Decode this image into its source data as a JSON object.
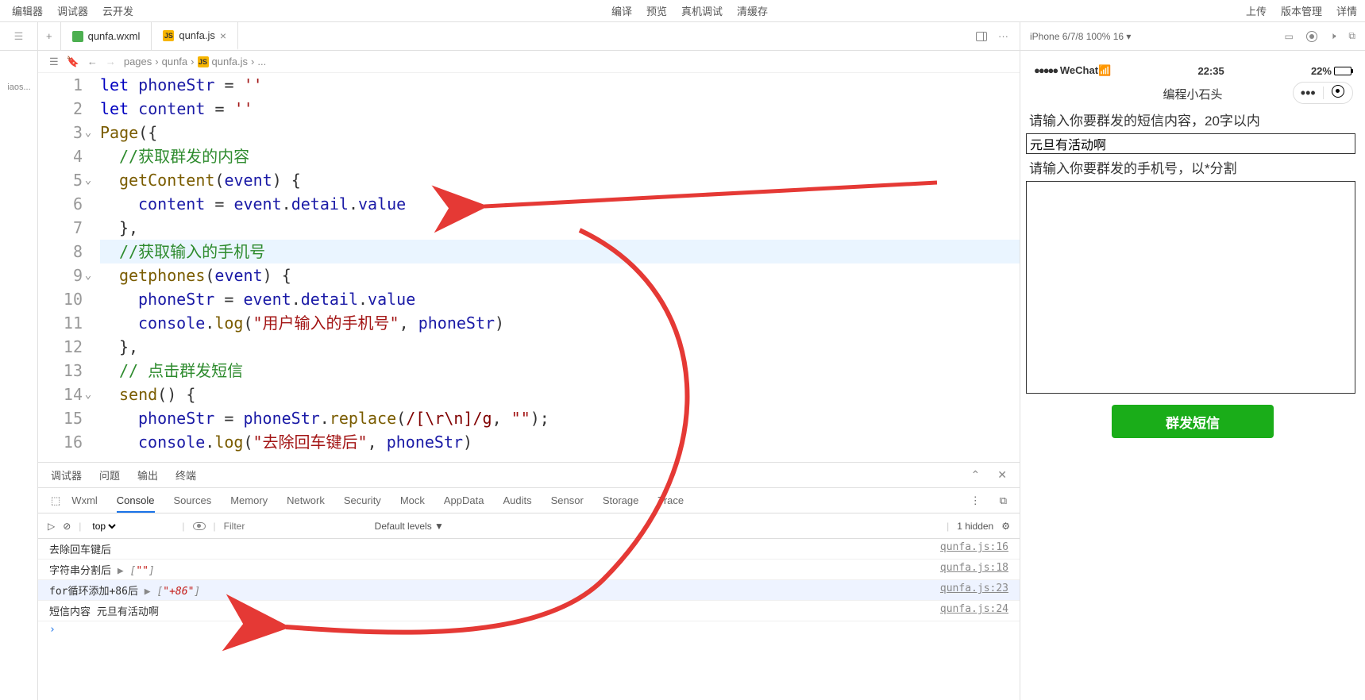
{
  "topbar": {
    "left": [
      "编辑器",
      "调试器",
      "云开发"
    ],
    "center": [
      "编译",
      "预览",
      "真机调试",
      "清缓存"
    ],
    "right": [
      "上传",
      "版本管理",
      "详情"
    ]
  },
  "sidebar": {
    "project_hint": "iaos..."
  },
  "tabs": [
    {
      "type": "wxml",
      "name": "qunfa.wxml",
      "active": false
    },
    {
      "type": "js",
      "name": "qunfa.js",
      "active": true
    }
  ],
  "breadcrumb": {
    "parts": [
      "pages",
      "qunfa",
      "qunfa.js",
      "..."
    ]
  },
  "code": {
    "lines": [
      {
        "n": 1,
        "tokens": [
          [
            "kw",
            "let"
          ],
          [
            "sp",
            " "
          ],
          [
            "id",
            "phoneStr"
          ],
          [
            "sp",
            " "
          ],
          [
            "op",
            "="
          ],
          [
            "sp",
            " "
          ],
          [
            "str",
            "''"
          ]
        ]
      },
      {
        "n": 2,
        "tokens": [
          [
            "kw",
            "let"
          ],
          [
            "sp",
            " "
          ],
          [
            "id",
            "content"
          ],
          [
            "sp",
            " "
          ],
          [
            "op",
            "="
          ],
          [
            "sp",
            " "
          ],
          [
            "str",
            "''"
          ]
        ]
      },
      {
        "n": 3,
        "fold": true,
        "tokens": [
          [
            "fn",
            "Page"
          ],
          [
            "p",
            "("
          ],
          [
            "p",
            "{"
          ]
        ]
      },
      {
        "n": 4,
        "indent": 1,
        "tokens": [
          [
            "com",
            "//获取群发的内容"
          ]
        ]
      },
      {
        "n": 5,
        "fold": true,
        "indent": 1,
        "tokens": [
          [
            "fn",
            "getContent"
          ],
          [
            "p",
            "("
          ],
          [
            "id",
            "event"
          ],
          [
            "p",
            ")"
          ],
          [
            "sp",
            " "
          ],
          [
            "p",
            "{"
          ]
        ]
      },
      {
        "n": 6,
        "indent": 2,
        "tokens": [
          [
            "id",
            "content"
          ],
          [
            "sp",
            " "
          ],
          [
            "op",
            "="
          ],
          [
            "sp",
            " "
          ],
          [
            "id",
            "event"
          ],
          [
            "p",
            "."
          ],
          [
            "id",
            "detail"
          ],
          [
            "p",
            "."
          ],
          [
            "id",
            "value"
          ]
        ]
      },
      {
        "n": 7,
        "indent": 1,
        "tokens": [
          [
            "p",
            "}"
          ],
          [
            "p",
            ","
          ]
        ]
      },
      {
        "n": 8,
        "hl": true,
        "indent": 1,
        "tokens": [
          [
            "com",
            "//获取输入的手机号"
          ]
        ]
      },
      {
        "n": 9,
        "fold": true,
        "indent": 1,
        "tokens": [
          [
            "fn",
            "getphones"
          ],
          [
            "p",
            "("
          ],
          [
            "id",
            "event"
          ],
          [
            "p",
            ")"
          ],
          [
            "sp",
            " "
          ],
          [
            "p",
            "{"
          ]
        ]
      },
      {
        "n": 10,
        "indent": 2,
        "tokens": [
          [
            "id",
            "phoneStr"
          ],
          [
            "sp",
            " "
          ],
          [
            "op",
            "="
          ],
          [
            "sp",
            " "
          ],
          [
            "id",
            "event"
          ],
          [
            "p",
            "."
          ],
          [
            "id",
            "detail"
          ],
          [
            "p",
            "."
          ],
          [
            "id",
            "value"
          ]
        ]
      },
      {
        "n": 11,
        "indent": 2,
        "tokens": [
          [
            "id",
            "console"
          ],
          [
            "p",
            "."
          ],
          [
            "fn",
            "log"
          ],
          [
            "p",
            "("
          ],
          [
            "str",
            "\"用户输入的手机号\""
          ],
          [
            "p",
            ","
          ],
          [
            "sp",
            " "
          ],
          [
            "id",
            "phoneStr"
          ],
          [
            "p",
            ")"
          ]
        ]
      },
      {
        "n": 12,
        "indent": 1,
        "tokens": [
          [
            "p",
            "}"
          ],
          [
            "p",
            ","
          ]
        ]
      },
      {
        "n": 13,
        "indent": 1,
        "tokens": [
          [
            "com",
            "// 点击群发短信"
          ]
        ]
      },
      {
        "n": 14,
        "fold": true,
        "indent": 1,
        "tokens": [
          [
            "fn",
            "send"
          ],
          [
            "p",
            "("
          ],
          [
            "p",
            ")"
          ],
          [
            "sp",
            " "
          ],
          [
            "p",
            "{"
          ]
        ]
      },
      {
        "n": 15,
        "indent": 2,
        "tokens": [
          [
            "id",
            "phoneStr"
          ],
          [
            "sp",
            " "
          ],
          [
            "op",
            "="
          ],
          [
            "sp",
            " "
          ],
          [
            "id",
            "phoneStr"
          ],
          [
            "p",
            "."
          ],
          [
            "fn",
            "replace"
          ],
          [
            "p",
            "("
          ],
          [
            "regex",
            "/[\\r\\n]/g"
          ],
          [
            "p",
            ","
          ],
          [
            "sp",
            " "
          ],
          [
            "str",
            "\"\""
          ],
          [
            "p",
            ")"
          ],
          [
            "p",
            ";"
          ]
        ]
      },
      {
        "n": 16,
        "indent": 2,
        "tokens": [
          [
            "id",
            "console"
          ],
          [
            "p",
            "."
          ],
          [
            "fn",
            "log"
          ],
          [
            "p",
            "("
          ],
          [
            "str",
            "\"去除回车键后\""
          ],
          [
            "p",
            ","
          ],
          [
            "sp",
            " "
          ],
          [
            "id",
            "phoneStr"
          ],
          [
            "p",
            ")"
          ]
        ]
      }
    ]
  },
  "debugger": {
    "tabs": [
      "调试器",
      "问题",
      "输出",
      "终端"
    ],
    "devtabs": [
      "Wxml",
      "Console",
      "Sources",
      "Memory",
      "Network",
      "Security",
      "Mock",
      "AppData",
      "Audits",
      "Sensor",
      "Storage",
      "Trace"
    ],
    "active_devtab": "Console",
    "toolbar": {
      "scope": "top",
      "filter_placeholder": "Filter",
      "levels": "Default levels ▼",
      "hidden": "1 hidden"
    },
    "logs": [
      {
        "msg": "去除回车键后",
        "src": "qunfa.js:16"
      },
      {
        "msg": "字符串分割后",
        "arr": "▶ [\"\"]",
        "src": "qunfa.js:18"
      },
      {
        "msg": "for循环添加+86后",
        "arr": "▶ [\"+86\"]",
        "src": "qunfa.js:23",
        "sel": true
      },
      {
        "msg": "短信内容 元旦有活动啊",
        "src": "qunfa.js:24"
      }
    ]
  },
  "preview": {
    "device_label": "iPhone 6/7/8 100% 16 ▾",
    "status": {
      "carrier": "WeChat",
      "time": "22:35",
      "battery": "22%"
    },
    "header_title": "编程小石头",
    "form": {
      "content_label": "请输入你要群发的短信内容，20字以内",
      "content_value": "元旦有活动啊",
      "phones_label": "请输入你要群发的手机号，以*分割",
      "button": "群发短信"
    }
  }
}
